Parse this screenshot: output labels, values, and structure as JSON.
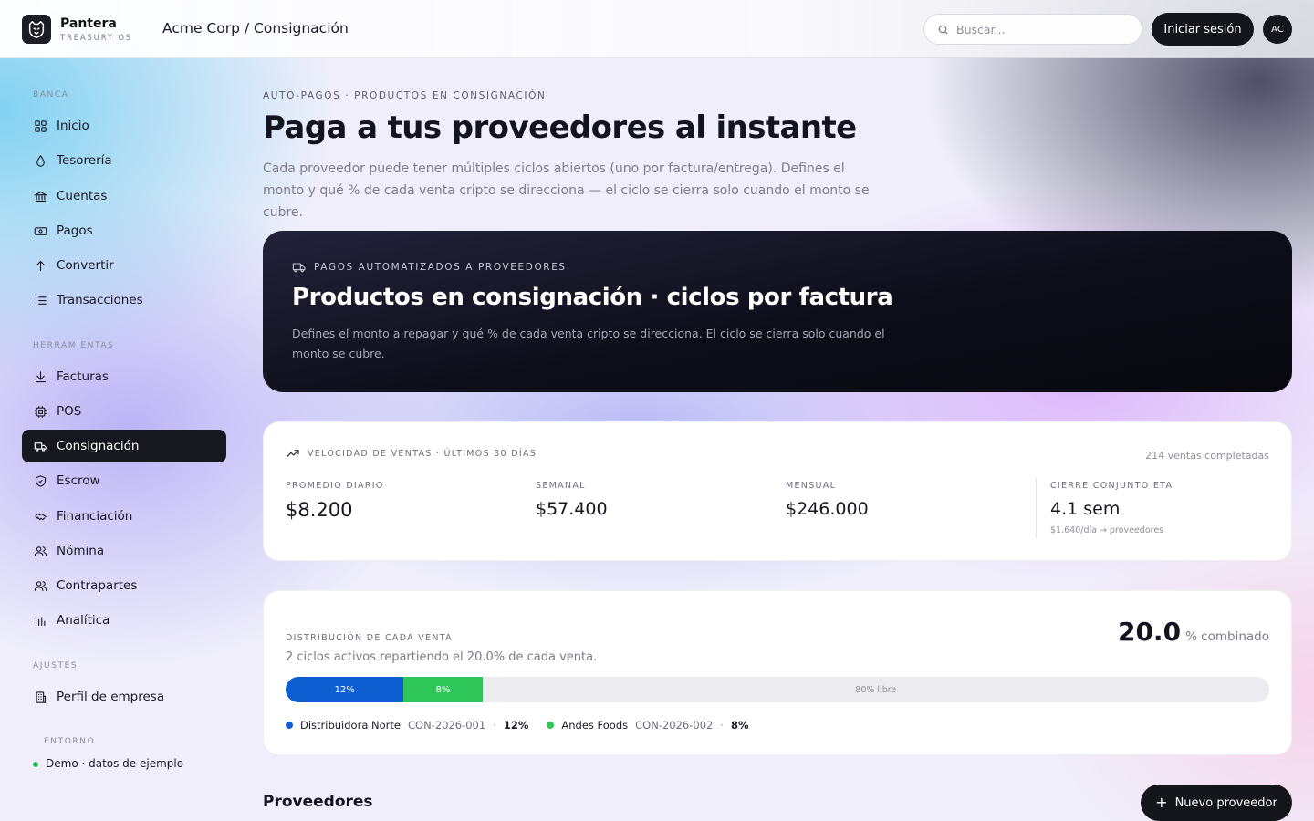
{
  "header": {
    "brand_name": "Pantera",
    "brand_sub": "TREASURY OS",
    "breadcrumb": "Acme Corp / Consignación",
    "search_placeholder": "Buscar...",
    "login_label": "Iniciar sesión",
    "avatar_initials": "AC"
  },
  "sidebar": {
    "sections": [
      "BANCA",
      "HERRAMIENTAS",
      "AJUSTES",
      "ENTORNO"
    ],
    "banca": [
      {
        "label": "Inicio",
        "icon": "grid-icon"
      },
      {
        "label": "Tesorería",
        "icon": "drop-icon"
      },
      {
        "label": "Cuentas",
        "icon": "bank-icon"
      },
      {
        "label": "Pagos",
        "icon": "banknote-icon"
      },
      {
        "label": "Convertir",
        "icon": "arrow-up-icon"
      },
      {
        "label": "Transacciones",
        "icon": "list-icon"
      }
    ],
    "herramientas": [
      {
        "label": "Facturas",
        "icon": "download-icon"
      },
      {
        "label": "POS",
        "icon": "chip-icon"
      },
      {
        "label": "Consignación",
        "icon": "truck-icon",
        "active": true
      },
      {
        "label": "Escrow",
        "icon": "shield-icon"
      },
      {
        "label": "Financiación",
        "icon": "handshake-icon"
      },
      {
        "label": "Nómina",
        "icon": "users-icon"
      },
      {
        "label": "Contrapartes",
        "icon": "users-icon"
      },
      {
        "label": "Analítica",
        "icon": "bar-chart-icon"
      }
    ],
    "ajustes": [
      {
        "label": "Perfil de empresa",
        "icon": "building-icon"
      }
    ],
    "environment": "Demo · datos de ejemplo"
  },
  "main": {
    "eyebrow": "AUTO-PAGOS · PRODUCTOS EN CONSIGNACIÓN",
    "title": "Paga a tus proveedores al instante",
    "lead": "Cada proveedor puede tener múltiples ciclos abiertos (uno por factura/entrega). Defines el monto y qué % de cada venta cripto se direcciona — el ciclo se cierra solo cuando el monto se cubre.",
    "hero": {
      "kicker": "PAGOS AUTOMATIZADOS A PROVEEDORES",
      "title": "Productos en consignación · ciclos por factura",
      "desc": "Defines el monto a repagar y qué % de cada venta cripto se direcciona. El ciclo se cierra solo cuando el monto se cubre."
    },
    "velocity": {
      "header": "VELOCIDAD DE VENTAS · ÚLTIMOS 30 DÍAS",
      "completed": "214 ventas completadas",
      "metrics": [
        {
          "label": "PROMEDIO DIARIO",
          "value": "$8.200"
        },
        {
          "label": "SEMANAL",
          "value": "$57.400"
        },
        {
          "label": "MENSUAL",
          "value": "$246.000"
        },
        {
          "label": "CIERRE CONJUNTO ETA",
          "value": "4.1 sem",
          "sub": "$1.640/día → proveedores"
        }
      ]
    },
    "distribution": {
      "label": "DISTRIBUCIÓN DE CADA VENTA",
      "subtitle": "2 ciclos activos repartiendo el 20.0% de cada venta.",
      "combined_value": "20.0",
      "combined_unit": "% combinado",
      "segments": [
        {
          "label": "12%",
          "percent": 12,
          "color": "#0d5fd1"
        },
        {
          "label": "8%",
          "percent": 8,
          "color": "#2fc75a"
        }
      ],
      "free": {
        "label": "80% libre",
        "percent": 80
      },
      "legend": [
        {
          "name": "Distribuidora Norte",
          "code": "CON-2026-001",
          "pct": "12%",
          "color": "#0d5fd1"
        },
        {
          "name": "Andes Foods",
          "code": "CON-2026-002",
          "pct": "8%",
          "color": "#2fc75a"
        }
      ],
      "separator": "·"
    },
    "providers": {
      "title": "Proveedores",
      "new_button": "Nuevo proveedor"
    }
  }
}
